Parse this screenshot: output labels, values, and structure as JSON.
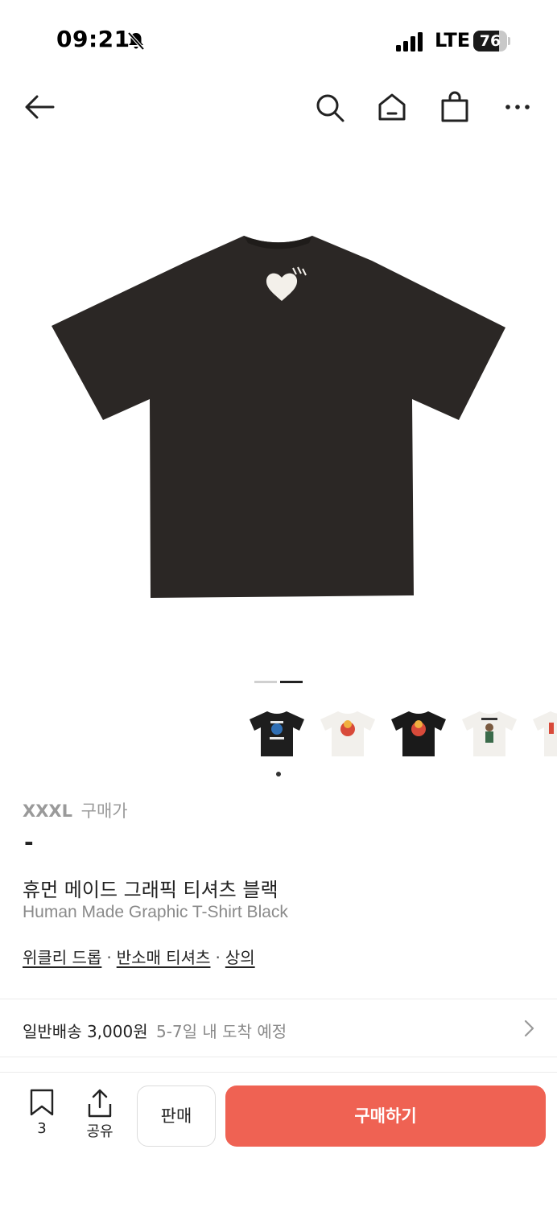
{
  "status_bar": {
    "time": "09:21",
    "network": "LTE",
    "battery_percent": "76",
    "battery_level": 0.76
  },
  "nav": {
    "icons": [
      "back-arrow-icon",
      "search-icon",
      "home-icon",
      "shopping-bag-icon",
      "more-icon"
    ]
  },
  "gallery": {
    "page_count": 2,
    "current_page": 2,
    "thumbnail_count": 5
  },
  "product": {
    "size": "XXXL",
    "size_label": "구매가",
    "price": "-",
    "name_ko": "휴먼 메이드 그래픽 티셔츠 블랙",
    "name_en": "Human Made Graphic T-Shirt Black",
    "categories": [
      "위클리 드롭",
      "반소매 티셔츠",
      "상의"
    ],
    "category_separator": "·"
  },
  "shipping": {
    "label": "일반배송 3,000원",
    "eta": "5-7일 내 도착 예정"
  },
  "bottom_bar": {
    "bookmark_count": "3",
    "share_label": "공유",
    "sell_label": "판매",
    "buy_label": "구매하기"
  },
  "colors": {
    "accent": "#ef6253",
    "muted_text": "#8a8a8a",
    "shirt": "#2b2725"
  }
}
